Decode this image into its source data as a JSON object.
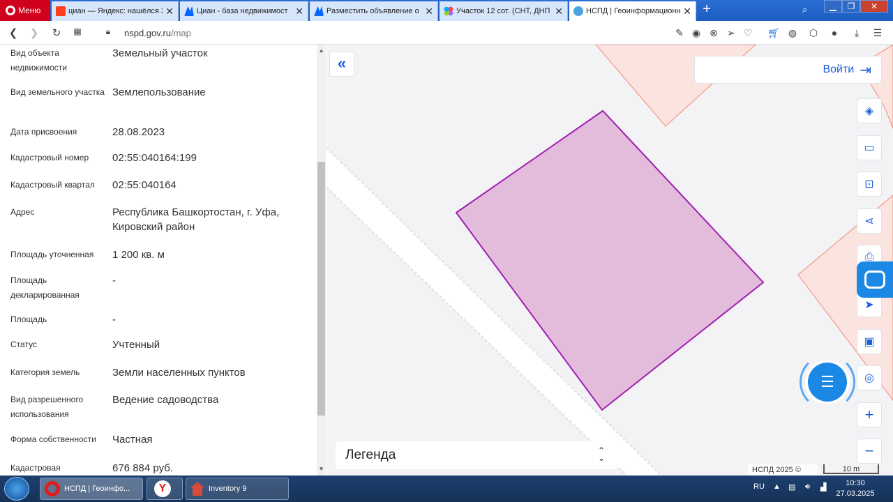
{
  "browser": {
    "menu_label": "Меню",
    "tabs": [
      {
        "title": "циан — Яндекс: нашёлся 3",
        "active": false
      },
      {
        "title": "Циан - база недвижимост",
        "active": false
      },
      {
        "title": "Разместить объявление о",
        "active": false
      },
      {
        "title": "Участок 12 сот. (СНТ, ДНП",
        "active": false
      },
      {
        "title": "НСПД | Геоинформационн",
        "active": true
      }
    ],
    "url_host": "nspd.gov.ru",
    "url_path": "/map"
  },
  "properties": [
    {
      "label": "Вид объекта недвижимости",
      "value": "Земельный участок"
    },
    {
      "label": "Вид земельного участка",
      "value": "Землепользование"
    },
    {
      "label": "Дата присвоения",
      "value": "28.08.2023"
    },
    {
      "label": "Кадастровый номер",
      "value": "02:55:040164:199"
    },
    {
      "label": "Кадастровый квартал",
      "value": "02:55:040164"
    },
    {
      "label": "Адрес",
      "value": "Республика Башкортостан, г. Уфа, Кировский район"
    },
    {
      "label": "Площадь уточненная",
      "value": "1 200 кв. м"
    },
    {
      "label": "Площадь декларированная",
      "value": "-"
    },
    {
      "label": "Площадь",
      "value": "-"
    },
    {
      "label": "Статус",
      "value": "Учтенный"
    },
    {
      "label": "Категория земель",
      "value": "Земли населенных пунктов"
    },
    {
      "label": "Вид разрешенного использования",
      "value": "Ведение садоводства"
    },
    {
      "label": "Форма собственности",
      "value": "Частная"
    },
    {
      "label": "Кадастровая",
      "value": "676 884 руб."
    }
  ],
  "map": {
    "login_label": "Войти",
    "legend_label": "Легенда",
    "attribution": "НСПД 2025 ©",
    "scale_label": "10 m",
    "tools": [
      "layers-icon",
      "ruler-icon",
      "search-area-icon",
      "share-icon",
      "print-icon",
      "locate-icon",
      "minimap-icon",
      "geo-search-icon",
      "zoom-in-icon",
      "zoom-out-icon"
    ],
    "colors": {
      "parcel_fill": "#e3bcdc",
      "parcel_stroke": "#a01fb0",
      "neighbor_stroke": "#f08a78",
      "accent": "#1b5fd8"
    }
  },
  "taskbar": {
    "items": [
      {
        "label": "НСПД | Геоинфо..."
      },
      {
        "label": ""
      },
      {
        "label": "Inventory 9"
      }
    ],
    "lang": "RU",
    "time": "10:30",
    "date": "27.03.2025"
  }
}
